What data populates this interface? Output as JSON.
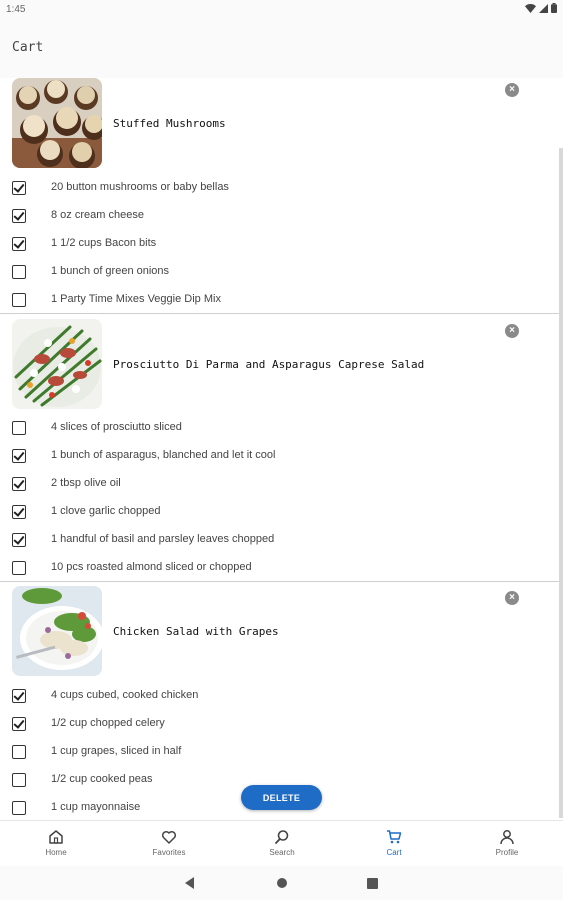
{
  "status_bar": {
    "time": "1:45"
  },
  "page": {
    "title": "Cart"
  },
  "recipes": [
    {
      "title": "Stuffed Mushrooms",
      "ingredients": [
        {
          "label": "20 button mushrooms or baby bellas",
          "checked": true
        },
        {
          "label": "8 oz cream cheese",
          "checked": true
        },
        {
          "label": "1 1/2 cups Bacon bits",
          "checked": true
        },
        {
          "label": "1 bunch of green onions",
          "checked": false
        },
        {
          "label": "1 Party Time Mixes Veggie Dip Mix",
          "checked": false
        }
      ]
    },
    {
      "title": "Prosciutto Di Parma and Asparagus Caprese Salad",
      "ingredients": [
        {
          "label": "4 slices of prosciutto sliced",
          "checked": false
        },
        {
          "label": "1 bunch of asparagus, blanched and let it cool",
          "checked": true
        },
        {
          "label": "2 tbsp olive oil",
          "checked": true
        },
        {
          "label": "1 clove garlic chopped",
          "checked": true
        },
        {
          "label": "1 handful of basil and parsley leaves chopped",
          "checked": true
        },
        {
          "label": "10 pcs roasted almond sliced or chopped",
          "checked": false
        }
      ]
    },
    {
      "title": "Chicken Salad with Grapes",
      "ingredients": [
        {
          "label": "4 cups cubed, cooked chicken",
          "checked": true
        },
        {
          "label": "1/2 cup chopped celery",
          "checked": true
        },
        {
          "label": "1 cup grapes, sliced in half",
          "checked": false
        },
        {
          "label": "1/2 cup cooked peas",
          "checked": false
        },
        {
          "label": "1 cup mayonnaise",
          "checked": false
        }
      ]
    }
  ],
  "actions": {
    "delete_label": "DELETE"
  },
  "bottom_nav": [
    {
      "label": "Home",
      "icon": "home-icon"
    },
    {
      "label": "Favorites",
      "icon": "heart-icon"
    },
    {
      "label": "Search",
      "icon": "search-icon"
    },
    {
      "label": "Cart",
      "icon": "cart-icon",
      "active": true
    },
    {
      "label": "Profile",
      "icon": "person-icon"
    }
  ],
  "colors": {
    "accent": "#1f6cc7",
    "divider": "#cfcfcf"
  }
}
